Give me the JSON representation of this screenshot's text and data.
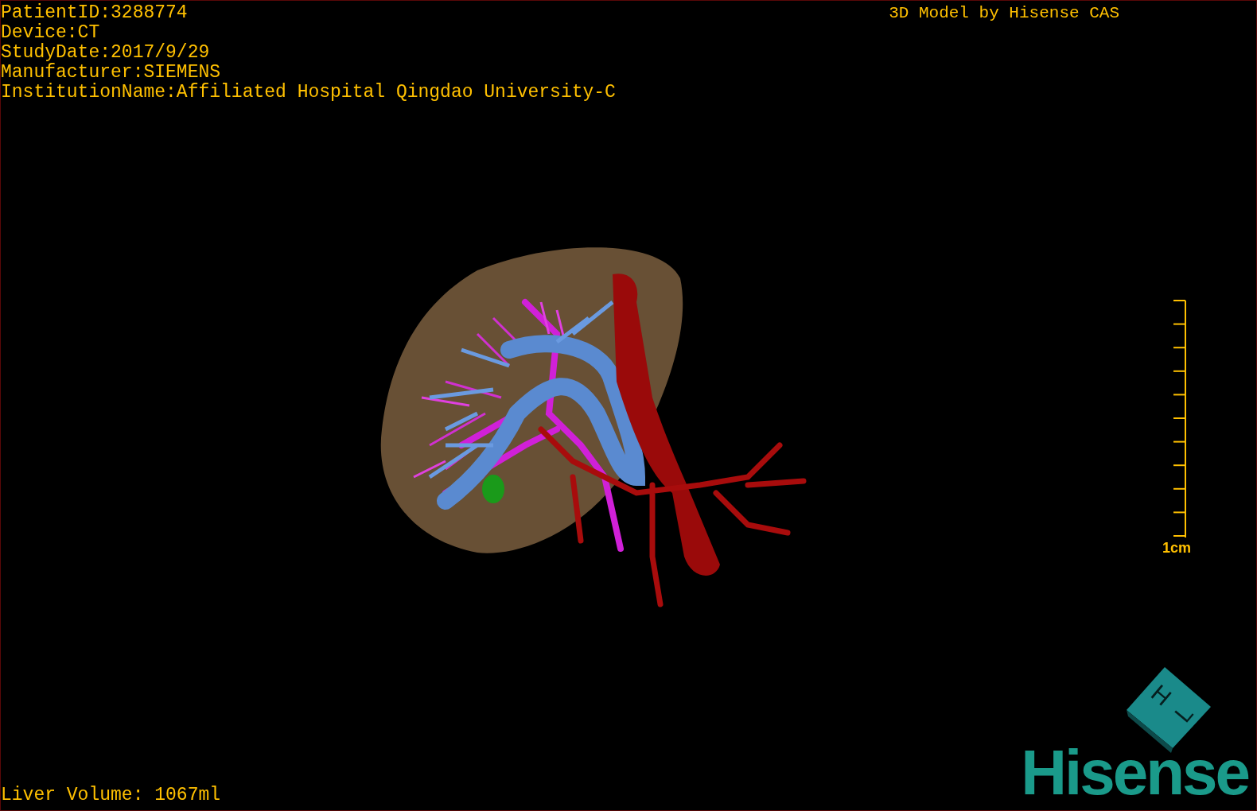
{
  "info_lines": [
    "PatientID:3288774",
    "Device:CT",
    "StudyDate:2017/9/29",
    "Manufacturer:SIEMENS",
    "InstitutionName:Affiliated Hospital Qingdao University-C"
  ],
  "title": "3D Model by Hisense CAS",
  "scale_bar": {
    "label": "1cm"
  },
  "liver_volume": "Liver Volume: 1067ml",
  "orientation_cube": {
    "faces": [
      "H",
      "L"
    ]
  },
  "logo": "Hisense"
}
